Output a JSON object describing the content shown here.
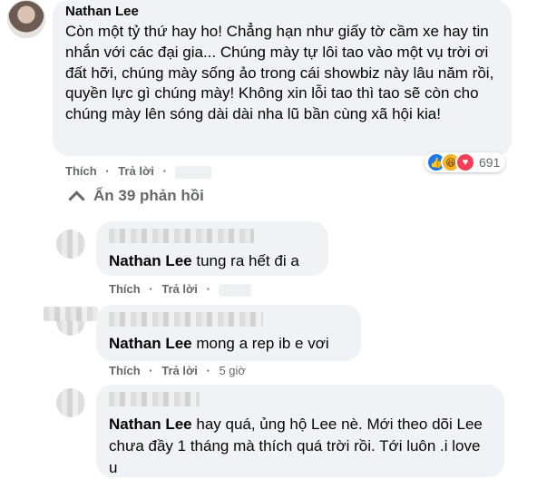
{
  "main_comment": {
    "author": "Nathan Lee",
    "text": "Còn một tỷ thứ hay ho! Chẳng hạn như giấy tờ cầm xe hay tin nhắn với các đại gia... Chúng mày tự lôi tao vào một vụ trời ơi đất hỡi, chúng mày sống ảo trong cái showbiz này lâu năm rồi, quyền lực gì chúng mày! Không xin lỗi tao thì tao sẽ còn cho chúng mày lên sóng dài dài nha lũ bần cùng xã hội kia!",
    "like_label": "Thích",
    "reply_label": "Trả lời",
    "reaction_icons": [
      "like-icon",
      "haha-icon",
      "love-icon"
    ],
    "reaction_count": "691"
  },
  "toggle": {
    "label": "Ẩn 39 phản hồi"
  },
  "replies": [
    {
      "mention": "Nathan Lee",
      "text": " tung ra hết đi a",
      "like_label": "Thích",
      "reply_label": "Trả lời",
      "time": ""
    },
    {
      "mention": "Nathan Lee",
      "text": " mong a rep ib e vơi",
      "like_label": "Thích",
      "reply_label": "Trả lời",
      "time": "5 giờ"
    },
    {
      "mention": "Nathan Lee",
      "text": " hay quá, ủng hộ Lee nè. Mới theo dõi Lee chưa đầy 1 tháng mà thích quá trời rồi. Tới luôn .i love u",
      "like_label": "",
      "reply_label": "",
      "time": ""
    }
  ],
  "colors": {
    "bubble_bg": "#f0f2f5",
    "meta_text": "#65676b",
    "like_blue": "#1877f2",
    "love_red": "#f33e58",
    "haha_yellow": "#f7b125"
  }
}
